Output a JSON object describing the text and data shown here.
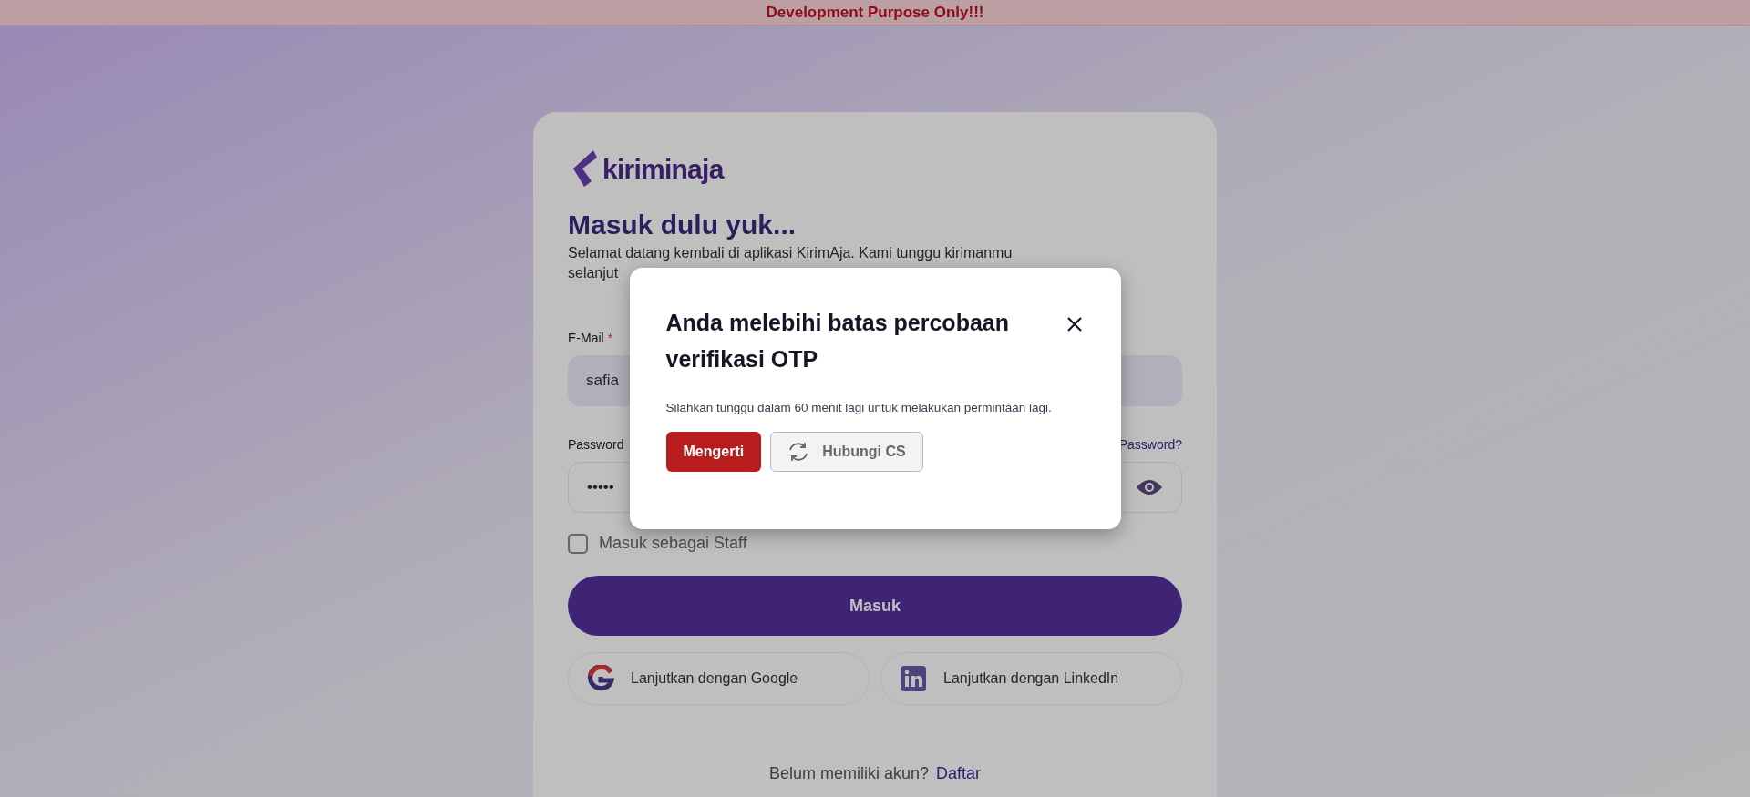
{
  "banner": {
    "text": "Development Purpose Only!!!"
  },
  "login": {
    "logo_text": "kiriminaja",
    "heading": "Masuk dulu yuk...",
    "subtitle_lines": [
      "Selamat datang kembali di aplikasi KirimAja. Kami tunggu kirimanmu",
      "selanjut"
    ],
    "email": {
      "label": "E-Mail",
      "required_mark": "*",
      "value": "safia"
    },
    "password": {
      "label": "Password",
      "forgot_link": "Password?",
      "value": "•••••"
    },
    "staff_checkbox": {
      "label": "Masuk sebagai Staff",
      "checked": false
    },
    "submit": "Masuk",
    "social_buttons": [
      {
        "kind": "google",
        "label": "Lanjutkan dengan Google"
      },
      {
        "kind": "linkedin",
        "label": "Lanjutkan dengan LinkedIn"
      }
    ],
    "signup": {
      "prompt": "Belum memiliki akun?",
      "link": "Daftar"
    }
  },
  "dialog": {
    "title": "Anda melebihi batas percobaan verifikasi OTP",
    "message": "Silahkan tunggu dalam 60 menit lagi untuk melakukan permintaan lagi.",
    "buttons": [
      {
        "kind": "primary",
        "label": "Mengerti"
      },
      {
        "kind": "secondary",
        "label": "Hubungi CS"
      }
    ]
  }
}
